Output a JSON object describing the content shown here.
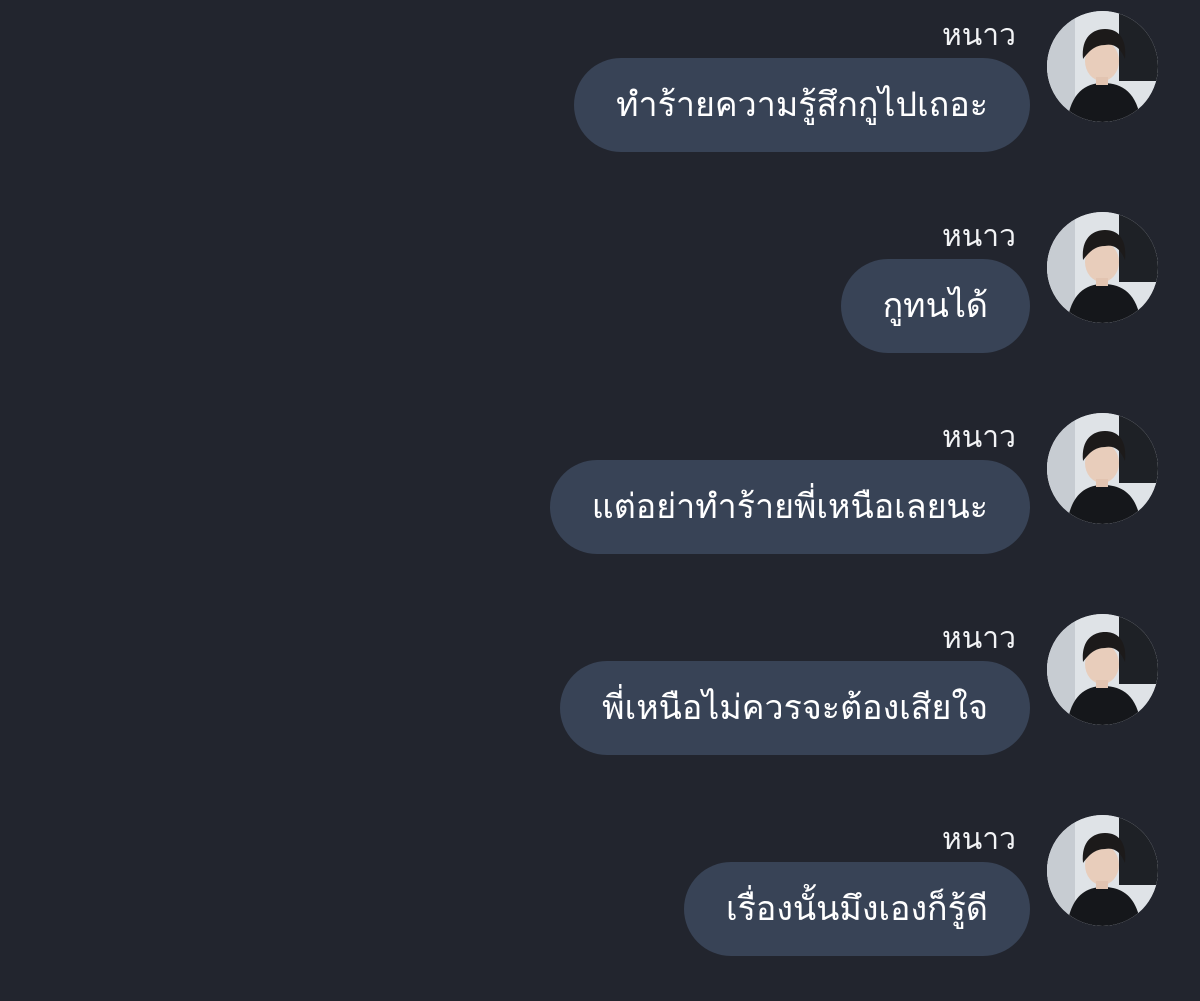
{
  "chat": {
    "messages": [
      {
        "sender": "หนาว",
        "text": "ทำร้ายความรู้สึกกูไปเถอะ",
        "avatar": "user-photo"
      },
      {
        "sender": "หนาว",
        "text": "กูทนได้",
        "avatar": "user-photo"
      },
      {
        "sender": "หนาว",
        "text": "แต่อย่าทำร้ายพี่เหนือเลยนะ",
        "avatar": "user-photo"
      },
      {
        "sender": "หนาว",
        "text": "พี่เหนือไม่ควรจะต้องเสียใจ",
        "avatar": "user-photo"
      },
      {
        "sender": "หนาว",
        "text": "เรื่องนั้นมึงเองก็รู้ดี",
        "avatar": "user-photo"
      }
    ]
  },
  "colors": {
    "background": "#22252e",
    "bubble": "#384356",
    "text": "#ffffff"
  }
}
